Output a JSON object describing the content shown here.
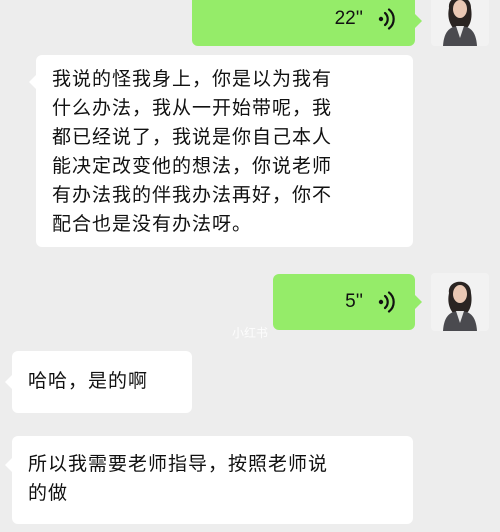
{
  "chat": {
    "messages": [
      {
        "id": "voice-1",
        "direction": "outgoing",
        "type": "voice",
        "duration": "22''"
      },
      {
        "id": "text-1",
        "direction": "incoming",
        "type": "text",
        "lines": [
          "我说的怪我身上，你是以为我有",
          "什么办法，我从一开始带呢，我",
          "都已经说了，我说是你自己本人",
          "能决定改变他的想法，你说老师",
          "有办法我的伴我办法再好，你不",
          "配合也是没有办法呀。"
        ]
      },
      {
        "id": "voice-2",
        "direction": "outgoing",
        "type": "voice",
        "duration": "5''"
      },
      {
        "id": "text-2",
        "direction": "incoming",
        "type": "text",
        "lines": [
          "哈哈，是的啊"
        ]
      },
      {
        "id": "text-3",
        "direction": "incoming",
        "type": "text",
        "lines": [
          "所以我需要老师指导，按照老师说",
          "的做"
        ]
      }
    ]
  },
  "watermark": "小红书",
  "icons": {
    "voice": "voice-wave-icon",
    "avatar": "user-avatar"
  },
  "colors": {
    "background": "#ededed",
    "outgoing_bubble": "#95ec69",
    "incoming_bubble": "#ffffff",
    "text": "#111111"
  }
}
